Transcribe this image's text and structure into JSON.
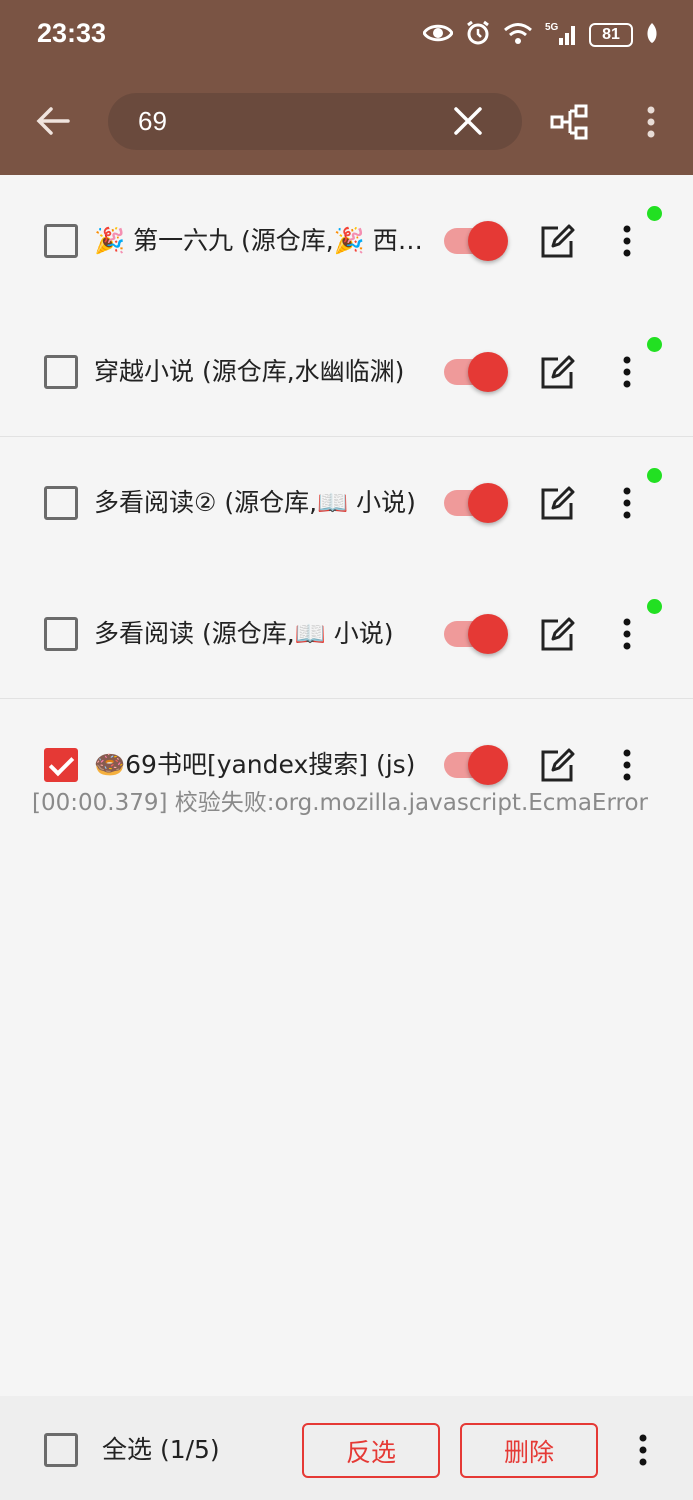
{
  "status_bar": {
    "time": "23:33",
    "battery": "81",
    "icons": [
      "eye-icon",
      "alarm-icon",
      "wifi-icon",
      "5g-signal-icon",
      "battery-icon",
      "leaf-icon"
    ]
  },
  "toolbar": {
    "search": {
      "value": "69",
      "placeholder": ""
    },
    "icons": [
      "back-arrow-icon",
      "close-icon",
      "group-icon",
      "more-vert-icon"
    ]
  },
  "colors": {
    "appbar": "#7a5444",
    "accent": "#e53935",
    "online_dot": "#22e022"
  },
  "sources": [
    {
      "title": "🎉 第一六九 (源仓库,🎉 西西推荐)",
      "checked": false,
      "enabled": true,
      "online": true,
      "error": ""
    },
    {
      "title": "穿越小说 (源仓库,水幽临渊)",
      "checked": false,
      "enabled": true,
      "online": true,
      "error": ""
    },
    {
      "title": "多看阅读② (源仓库,📖 小说)",
      "checked": false,
      "enabled": true,
      "online": true,
      "error": ""
    },
    {
      "title": "多看阅读 (源仓库,📖 小说)",
      "checked": false,
      "enabled": true,
      "online": true,
      "error": ""
    },
    {
      "title": "🍩69书吧[yandex搜索] (js)",
      "checked": true,
      "enabled": true,
      "online": false,
      "error": "[00:00.379] 校验失败:org.mozilla.javascript.EcmaError"
    }
  ],
  "bottom_bar": {
    "select_all_label": "全选 (1/5)",
    "invert_label": "反选",
    "delete_label": "删除"
  }
}
